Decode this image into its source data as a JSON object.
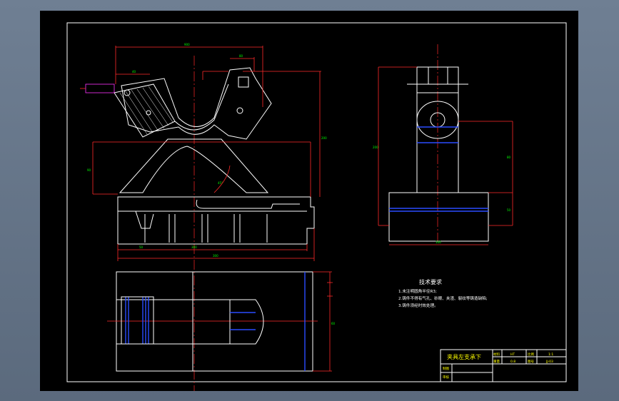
{
  "colors": {
    "background": "#000000",
    "outline": "#ffffff",
    "dimension": "#ff2a2a",
    "centerline": "#ff2a2a",
    "hidden": "#2a4cff",
    "title_text": "#ffff00",
    "dim_text": "#00ff00"
  },
  "tech_requirements": {
    "heading": "技术要求",
    "items": [
      "1.未注明圆角半径R3;",
      "2.铸件不得有气孔、砂眼、夹渣、裂纹等铸造缺陷;",
      "3.铸件须经时效处理。"
    ]
  },
  "title_block": {
    "drawing_name": "夹具左支承下",
    "material_label": "材料",
    "material_value": "HT",
    "scale_label": "比例",
    "scale_value": "1:1",
    "weight_label": "重量",
    "weight_value": "0.8",
    "sheet_label": "图号",
    "sheet_value": "JJ-03",
    "draw_label": "制图",
    "check_label": "审核"
  },
  "dims": {
    "front_top": "900",
    "front_left_top": "40",
    "front_right_top": "80",
    "front_height": "200",
    "front_left_height": "90",
    "front_angle": "45°",
    "front_bottom_a": "50",
    "front_bottom_b": "300",
    "front_bottom_total": "300",
    "side_total": "200",
    "side_mid": "80",
    "side_low": "50",
    "side_bottom": "100",
    "plan_height": "60"
  }
}
